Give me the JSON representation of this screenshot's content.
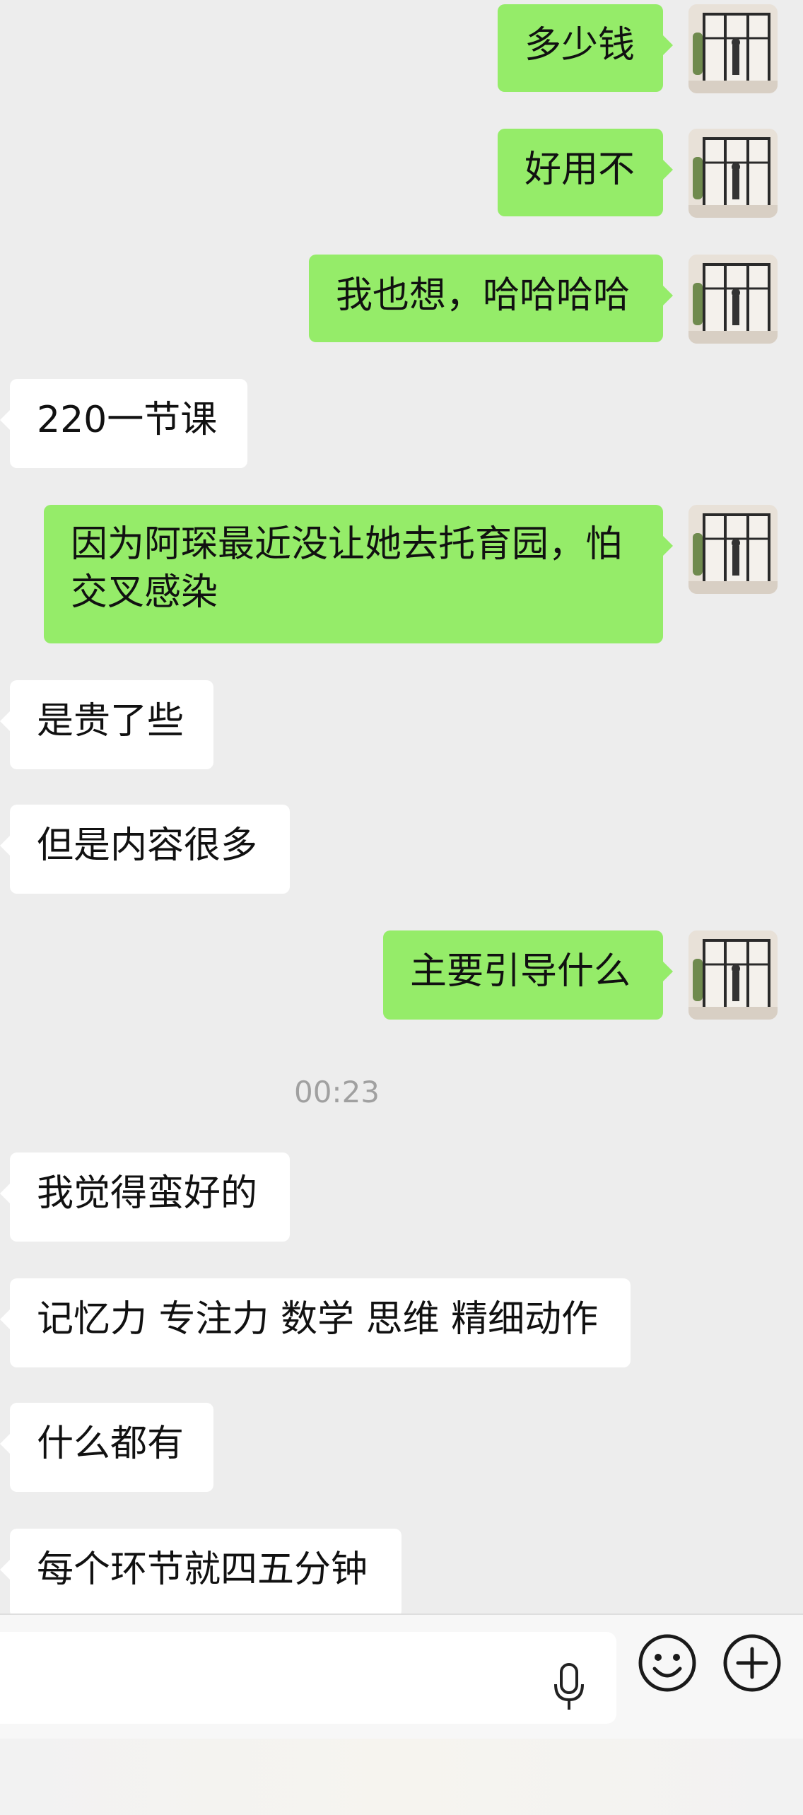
{
  "messages": [
    {
      "side": "me",
      "text": "多少钱"
    },
    {
      "side": "me",
      "text": "好用不"
    },
    {
      "side": "me",
      "text": "我也想，哈哈哈哈"
    },
    {
      "side": "them",
      "text": "220一节课"
    },
    {
      "side": "me",
      "text": "因为阿琛最近没让她去托育园，怕交叉感染"
    },
    {
      "side": "them",
      "text": "是贵了些"
    },
    {
      "side": "them",
      "text": "但是内容很多"
    },
    {
      "side": "me",
      "text": "主要引导什么"
    },
    {
      "side": "them",
      "text": "我觉得蛮好的"
    },
    {
      "side": "them",
      "text": "记忆力 专注力 数学 思维 精细动作"
    },
    {
      "side": "them",
      "text": "什么都有"
    },
    {
      "side": "them",
      "text": "每个环节就四五分钟"
    }
  ],
  "timestamp": "00:23",
  "input": {
    "value": "",
    "icons": [
      "microphone-icon",
      "emoji-icon",
      "plus-icon"
    ]
  },
  "colors": {
    "my_bubble": "#95ec69",
    "their_bubble": "#ffffff",
    "background": "#ededed"
  }
}
